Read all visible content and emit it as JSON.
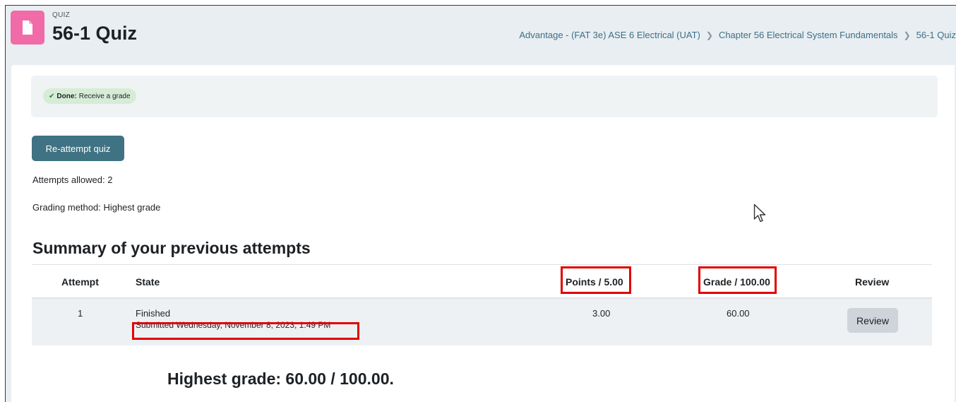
{
  "header": {
    "label": "QUIZ",
    "title": "56-1 Quiz",
    "icon": "quiz-document-icon",
    "icon_color": "#f06ba8"
  },
  "breadcrumb": [
    "Advantage - (FAT 3e) ASE 6 Electrical (UAT)",
    "Chapter 56 Electrical System Fundamentals",
    "56-1 Quiz"
  ],
  "completion": {
    "status": "Done:",
    "text": "Receive a grade"
  },
  "actions": {
    "reattempt_label": "Re-attempt quiz"
  },
  "info": {
    "attempts_allowed": "Attempts allowed: 2",
    "grading_method": "Grading method: Highest grade"
  },
  "summary": {
    "heading": "Summary of your previous attempts",
    "columns": [
      "Attempt",
      "State",
      "Points / 5.00",
      "Grade / 100.00",
      "Review"
    ],
    "rows": [
      {
        "attempt": "1",
        "state": "Finished",
        "submitted": "Submitted Wednesday, November 8, 2023, 1:49 PM",
        "points": "3.00",
        "grade": "60.00",
        "review_label": "Review"
      }
    ]
  },
  "highest_grade": "Highest grade: 60.00 / 100.00.",
  "colors": {
    "primary_button": "#3f7283",
    "highlight_box": "#e00000",
    "done_badge": "#d6ecd7"
  }
}
